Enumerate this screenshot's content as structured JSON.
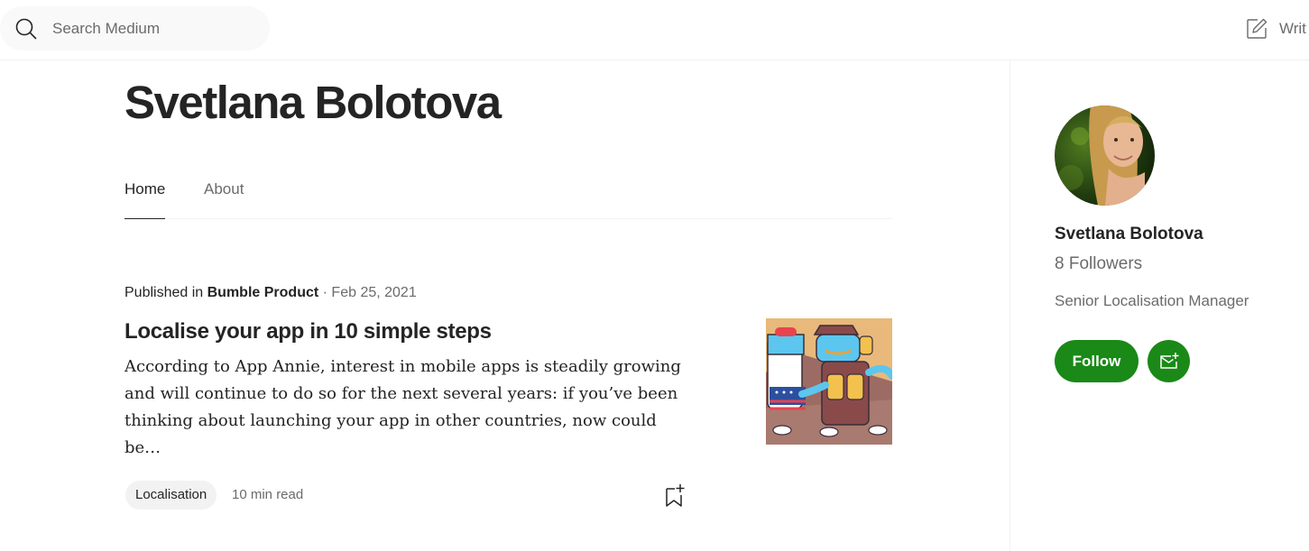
{
  "header": {
    "search_placeholder": "Search Medium",
    "write_label": "Writ"
  },
  "profile": {
    "name": "Svetlana Bolotova"
  },
  "tabs": [
    {
      "label": "Home",
      "active": true
    },
    {
      "label": "About",
      "active": false
    }
  ],
  "post": {
    "published_in_label": "Published in",
    "publication": "Bumble Product",
    "separator": "·",
    "date": "Feb 25, 2021",
    "title": "Localise your app in 10 simple steps",
    "excerpt": "According to App Annie, interest in mobile apps is steadily growing and will continue to do so for the next several years: if you’ve been thinking about launching your app in other countries, now could be…",
    "tag": "Localisation",
    "read_time": "10 min read"
  },
  "sidebar": {
    "name": "Svetlana Bolotova",
    "followers": "8 Followers",
    "bio": "Senior Localisation Manager",
    "follow_label": "Follow"
  },
  "colors": {
    "accent_green": "#1a8917",
    "text_primary": "#242424",
    "text_secondary": "#6b6b6b"
  },
  "icons": {
    "search": "search-icon",
    "write": "write-icon",
    "bookmark": "bookmark-add-icon",
    "subscribe": "mail-plus-icon"
  }
}
